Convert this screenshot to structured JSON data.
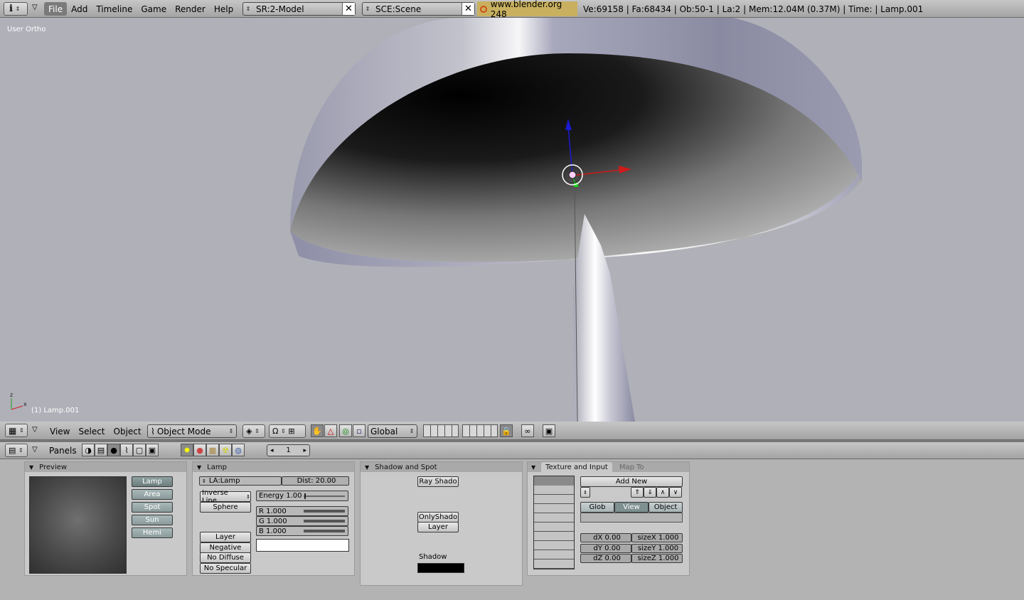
{
  "topbar": {
    "info_icon": "info-icon",
    "menus": [
      "File",
      "Add",
      "Timeline",
      "Game",
      "Render",
      "Help"
    ],
    "active_menu": "File",
    "screen": "SR:2-Model",
    "scene": "SCE:Scene",
    "website": "www.blender.org 248",
    "stats": "Ve:69158 | Fa:68434 | Ob:50-1 | La:2  | Mem:12.04M (0.37M)  | Time: | Lamp.001"
  },
  "viewport": {
    "view_label": "User Ortho",
    "object_label": "(1) Lamp.001",
    "colors": {
      "background": "#b0b0b8",
      "shade_outer": "#9a9ab0"
    }
  },
  "viewport_header": {
    "menus": [
      "View",
      "Select",
      "Object"
    ],
    "mode": "Object Mode",
    "orientation": "Global"
  },
  "buttons_header": {
    "panels_label": "Panels",
    "frame": "1"
  },
  "preview_panel": {
    "title": "Preview",
    "types": [
      "Lamp",
      "Area",
      "Spot",
      "Sun",
      "Hemi"
    ],
    "selected": "Lamp"
  },
  "lamp_panel": {
    "title": "Lamp",
    "name": "LA:Lamp",
    "dist": "Dist: 20.00",
    "falloff": "Inverse Line",
    "sphere": "Sphere",
    "energy": "Energy 1.00",
    "r": "R 1.000",
    "g": "G 1.000",
    "b": "B 1.000",
    "toggles": [
      "Layer",
      "Negative",
      "No Diffuse",
      "No Specular"
    ]
  },
  "shadow_panel": {
    "title": "Shadow and Spot",
    "ray_shadow": "Ray Shado",
    "only_shadow": "OnlyShado",
    "layer": "Layer",
    "shadow_label": "Shadow"
  },
  "texture_panel": {
    "tab_active": "Texture and Input",
    "tab_inactive": "Map To",
    "add_new": "Add New",
    "coords": [
      "Glob",
      "View",
      "Object"
    ],
    "coord_selected": "View",
    "dx": "dX 0.00",
    "dy": "dY 0.00",
    "dz": "dZ 0.00",
    "sizex": "sizeX 1.000",
    "sizey": "sizeY 1.000",
    "sizez": "sizeZ 1.000"
  }
}
